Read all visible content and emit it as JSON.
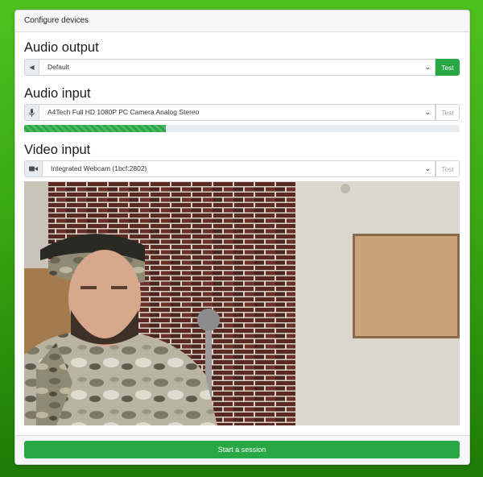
{
  "header": {
    "title": "Configure devices"
  },
  "audio_output": {
    "title": "Audio output",
    "icon": "speaker-icon",
    "selected": "Default",
    "test_label": "Test"
  },
  "audio_input": {
    "title": "Audio input",
    "icon": "microphone-icon",
    "selected": "A4Tech Full HD 1080P PC Camera Analog Stereo",
    "test_label": "Test",
    "level_fraction": 0.325
  },
  "video_input": {
    "title": "Video input",
    "icon": "video-camera-icon",
    "selected": "Integrated Webcam (1bcf:2802)",
    "test_label": "Test"
  },
  "footer": {
    "start_label": "Start a session"
  },
  "colors": {
    "accent": "#28a745",
    "background_green": "#39a812"
  }
}
